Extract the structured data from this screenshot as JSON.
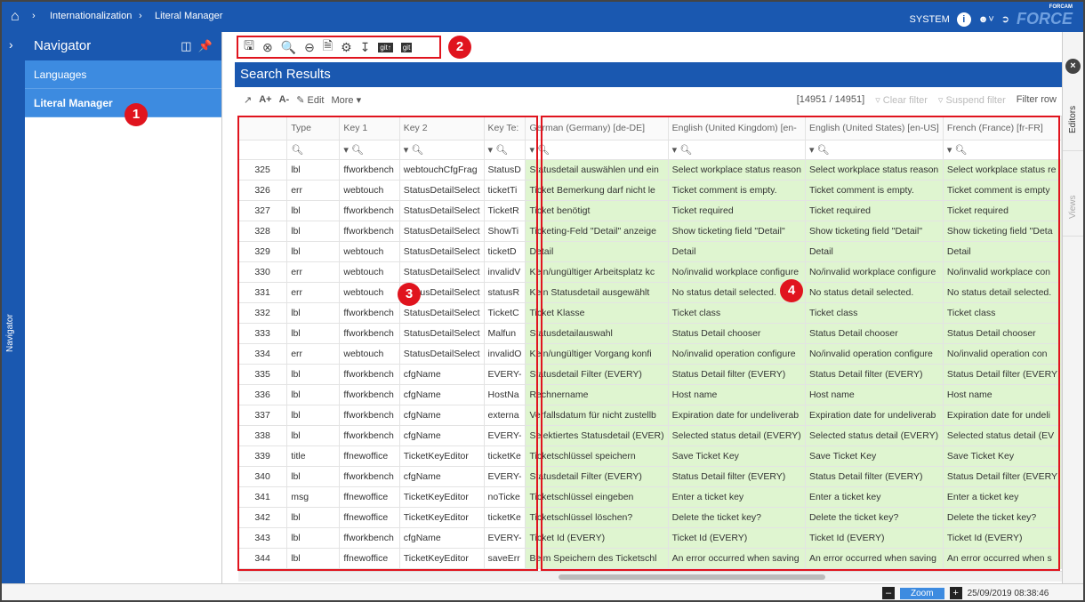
{
  "topbar": {
    "breadcrumb": [
      "Internationalization",
      "Literal Manager"
    ],
    "user": "SYSTEM",
    "logo_text": "FORCE",
    "logo_super": "FORCAM"
  },
  "navigator": {
    "title": "Navigator",
    "items": [
      {
        "label": "Languages"
      },
      {
        "label": "Literal Manager"
      }
    ],
    "strip_label": "Navigator"
  },
  "main": {
    "title": "Search Results",
    "edit_label": "Edit",
    "more_label": "More",
    "count": "[14951 / 14951]",
    "clear_filter": "Clear filter",
    "suspend_filter": "Suspend filter",
    "filter_row": "Filter row"
  },
  "right_tabs": [
    "Editors",
    "Views"
  ],
  "columns": [
    "",
    "Type",
    "Key 1",
    "Key 2",
    "Key Te:",
    "German (Germany) [de-DE]",
    "English (United Kingdom) [en-",
    "English (United States) [en-US]",
    "French (France) [fr-FR]"
  ],
  "rows": [
    [
      "325",
      "lbl",
      "ffworkbench",
      "webtouchCfgFrag",
      "StatusD",
      "Statusdetail auswählen und ein",
      "Select workplace status reason",
      "Select workplace status reason",
      "Select workplace status re"
    ],
    [
      "326",
      "err",
      "webtouch",
      "StatusDetailSelect",
      "ticketTi",
      "Ticket Bemerkung darf nicht le",
      "Ticket comment is empty.",
      "Ticket comment is empty.",
      "Ticket comment is empty"
    ],
    [
      "327",
      "lbl",
      "ffworkbench",
      "StatusDetailSelect",
      "TicketR",
      "Ticket benötigt",
      "Ticket required",
      "Ticket required",
      "Ticket required"
    ],
    [
      "328",
      "lbl",
      "ffworkbench",
      "StatusDetailSelect",
      "ShowTi",
      "Ticketing-Feld \"Detail\" anzeige",
      "Show ticketing field \"Detail\"",
      "Show ticketing field \"Detail\"",
      "Show ticketing field \"Deta"
    ],
    [
      "329",
      "lbl",
      "webtouch",
      "StatusDetailSelect",
      "ticketD",
      "Detail",
      "Detail",
      "Detail",
      "Detail"
    ],
    [
      "330",
      "err",
      "webtouch",
      "StatusDetailSelect",
      "invalidV",
      "Kein/ungültiger Arbeitsplatz kc",
      "No/invalid workplace configure",
      "No/invalid workplace configure",
      "No/invalid workplace con"
    ],
    [
      "331",
      "err",
      "webtouch",
      "StatusDetailSelect",
      "statusR",
      "Kein Statusdetail ausgewählt",
      "No status detail selected.",
      "No status detail selected.",
      "No status detail selected."
    ],
    [
      "332",
      "lbl",
      "ffworkbench",
      "StatusDetailSelect",
      "TicketC",
      "Ticket Klasse",
      "Ticket class",
      "Ticket class",
      "Ticket class"
    ],
    [
      "333",
      "lbl",
      "ffworkbench",
      "StatusDetailSelect",
      "Malfun",
      "Statusdetailauswahl",
      "Status Detail chooser",
      "Status Detail chooser",
      "Status Detail chooser"
    ],
    [
      "334",
      "err",
      "webtouch",
      "StatusDetailSelect",
      "invalidO",
      "Kein/ungültiger Vorgang konfi",
      "No/invalid operation configure",
      "No/invalid operation configure",
      "No/invalid operation con"
    ],
    [
      "335",
      "lbl",
      "ffworkbench",
      "cfgName",
      "EVERY-",
      "Statusdetail Filter (EVERY)",
      "Status Detail filter (EVERY)",
      "Status Detail filter (EVERY)",
      "Status Detail filter (EVERY"
    ],
    [
      "336",
      "lbl",
      "ffworkbench",
      "cfgName",
      "HostNa",
      "Rechnername",
      "Host name",
      "Host name",
      "Host name"
    ],
    [
      "337",
      "lbl",
      "ffworkbench",
      "cfgName",
      "externa",
      "Verfallsdatum für nicht zustellb",
      "Expiration date for undeliverab",
      "Expiration date for undeliverab",
      "Expiration date for undeli"
    ],
    [
      "338",
      "lbl",
      "ffworkbench",
      "cfgName",
      "EVERY-",
      "Selektiertes Statusdetail (EVER)",
      "Selected status detail (EVERY)",
      "Selected status detail (EVERY)",
      "Selected status detail (EV"
    ],
    [
      "339",
      "title",
      "ffnewoffice",
      "TicketKeyEditor",
      "ticketKe",
      "Ticketschlüssel speichern",
      "Save Ticket Key",
      "Save Ticket Key",
      "Save Ticket Key"
    ],
    [
      "340",
      "lbl",
      "ffworkbench",
      "cfgName",
      "EVERY-",
      "Statusdetail Filter (EVERY)",
      "Status Detail filter (EVERY)",
      "Status Detail filter (EVERY)",
      "Status Detail filter (EVERY"
    ],
    [
      "341",
      "msg",
      "ffnewoffice",
      "TicketKeyEditor",
      "noTicke",
      "Ticketschlüssel eingeben",
      "Enter a ticket key",
      "Enter a ticket key",
      "Enter a ticket key"
    ],
    [
      "342",
      "lbl",
      "ffnewoffice",
      "TicketKeyEditor",
      "ticketKe",
      "Ticketschlüssel löschen?",
      "Delete the ticket key?",
      "Delete the ticket key?",
      "Delete the ticket key?"
    ],
    [
      "343",
      "lbl",
      "ffworkbench",
      "cfgName",
      "EVERY-",
      "Ticket Id (EVERY)",
      "Ticket Id (EVERY)",
      "Ticket Id (EVERY)",
      "Ticket Id (EVERY)"
    ],
    [
      "344",
      "lbl",
      "ffnewoffice",
      "TicketKeyEditor",
      "saveErr",
      "Beim Speichern des Ticketschl",
      "An error occurred when saving",
      "An error occurred when saving",
      "An error occurred when s"
    ]
  ],
  "annotations": [
    "1",
    "2",
    "3",
    "4"
  ],
  "status": {
    "zoom": "Zoom",
    "datetime": "25/09/2019  08:38:46"
  }
}
